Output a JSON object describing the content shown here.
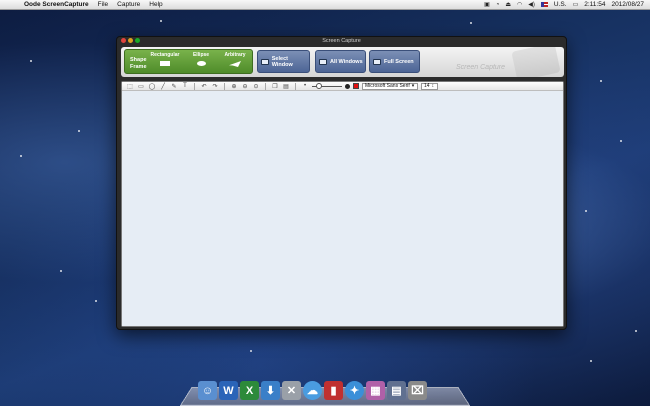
{
  "menubar": {
    "app_name": "Oode ScreenCapture",
    "menus": [
      "File",
      "Capture",
      "Help"
    ],
    "status_input": "U.S.",
    "clock_time": "2:11:54",
    "clock_date": "2012/08/27"
  },
  "window": {
    "title": "Screen Capture",
    "shape_frame_label": "Shape Frame",
    "shapes": [
      "Rectangular",
      "Ellipse",
      "Arbitrary"
    ],
    "capture_buttons": {
      "select_window": "Select Window",
      "all_windows": "All Windows",
      "full_screen": "Full Screen"
    },
    "watermark": "Screen Capture"
  },
  "editor": {
    "font_name": "Microsoft Sans Serif",
    "font_size": "14",
    "color": "#e01010"
  },
  "dock": {
    "icons": [
      "finder-icon",
      "word-icon",
      "excel-icon",
      "download-icon",
      "utilities-icon",
      "messages-icon",
      "app-icon",
      "safari-icon",
      "photos-icon",
      "system-icon",
      "trash-icon"
    ]
  }
}
